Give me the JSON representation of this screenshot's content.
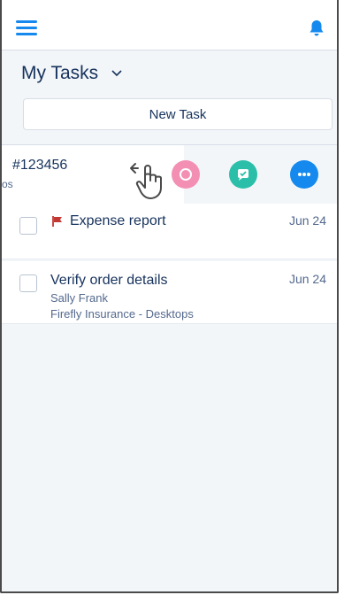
{
  "header": {
    "menu_icon": "hamburger-menu-icon",
    "notification_icon": "bell-icon",
    "accent": "#1589ee"
  },
  "list": {
    "title": "My Tasks",
    "new_task_label": "New Task"
  },
  "swiped_item": {
    "number": "#123456",
    "subtitle_fragment": "os",
    "actions": [
      "pink-action",
      "edit-task-icon",
      "more-actions-icon"
    ]
  },
  "tasks": [
    {
      "title": "Expense report",
      "date": "Jun 24",
      "flagged": true
    },
    {
      "title": "Verify order details",
      "date": "Jun 24",
      "contact": "Sally Frank",
      "account": "Firefly Insurance - Desktops"
    }
  ]
}
